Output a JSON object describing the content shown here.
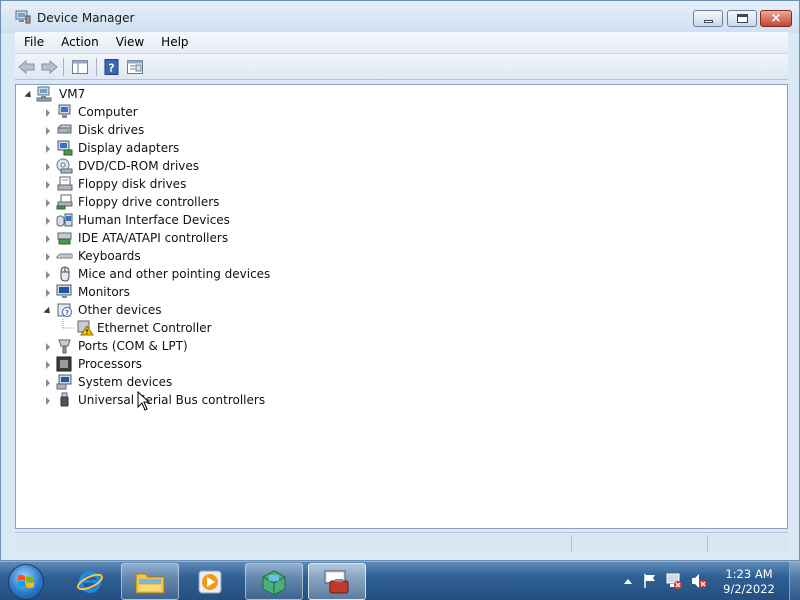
{
  "window": {
    "title": "Device Manager",
    "title_icon": "device-manager-icon",
    "controls": {
      "minimize": "minimize-icon",
      "maximize": "maximize-icon",
      "close": "×"
    }
  },
  "menu": {
    "items": [
      "File",
      "Action",
      "View",
      "Help"
    ]
  },
  "toolbar": {
    "buttons": [
      "back-arrow-icon",
      "forward-arrow-icon",
      "show-hide-console-tree-icon",
      "help-icon",
      "properties-icon"
    ]
  },
  "tree": {
    "root": "VM7",
    "categories": [
      {
        "label": "Computer",
        "icon": "computer-icon",
        "expanded": false
      },
      {
        "label": "Disk drives",
        "icon": "disk-drive-icon",
        "expanded": false
      },
      {
        "label": "Display adapters",
        "icon": "display-adapter-icon",
        "expanded": false
      },
      {
        "label": "DVD/CD-ROM drives",
        "icon": "dvd-drive-icon",
        "expanded": false
      },
      {
        "label": "Floppy disk drives",
        "icon": "floppy-drive-icon",
        "expanded": false
      },
      {
        "label": "Floppy drive controllers",
        "icon": "floppy-controller-icon",
        "expanded": false
      },
      {
        "label": "Human Interface Devices",
        "icon": "hid-icon",
        "expanded": false
      },
      {
        "label": "IDE ATA/ATAPI controllers",
        "icon": "ide-controller-icon",
        "expanded": false
      },
      {
        "label": "Keyboards",
        "icon": "keyboard-icon",
        "expanded": false
      },
      {
        "label": "Mice and other pointing devices",
        "icon": "mouse-icon",
        "expanded": false
      },
      {
        "label": "Monitors",
        "icon": "monitor-icon",
        "expanded": false
      },
      {
        "label": "Other devices",
        "icon": "unknown-device-icon",
        "expanded": true,
        "children": [
          {
            "label": "Ethernet Controller",
            "icon": "warning-device-icon"
          }
        ]
      },
      {
        "label": "Ports (COM & LPT)",
        "icon": "port-icon",
        "expanded": false
      },
      {
        "label": "Processors",
        "icon": "processor-icon",
        "expanded": false
      },
      {
        "label": "System devices",
        "icon": "system-device-icon",
        "expanded": false
      },
      {
        "label": "Universal Serial Bus controllers",
        "icon": "usb-icon",
        "expanded": false
      }
    ]
  },
  "taskbar": {
    "pinned": [
      "internet-explorer-icon",
      "windows-explorer-icon",
      "media-player-icon",
      "app-icon",
      "device-manager-icon"
    ],
    "clock": {
      "time": "1:23 AM",
      "date": "9/2/2022"
    },
    "tray": [
      "show-hidden-icons-icon",
      "action-center-flag-icon",
      "network-disconnected-icon",
      "volume-muted-icon"
    ]
  },
  "colors": {
    "title_bar": "#dbe8f6",
    "taskbar": "#2f5f92",
    "warning": "#f2c400"
  }
}
